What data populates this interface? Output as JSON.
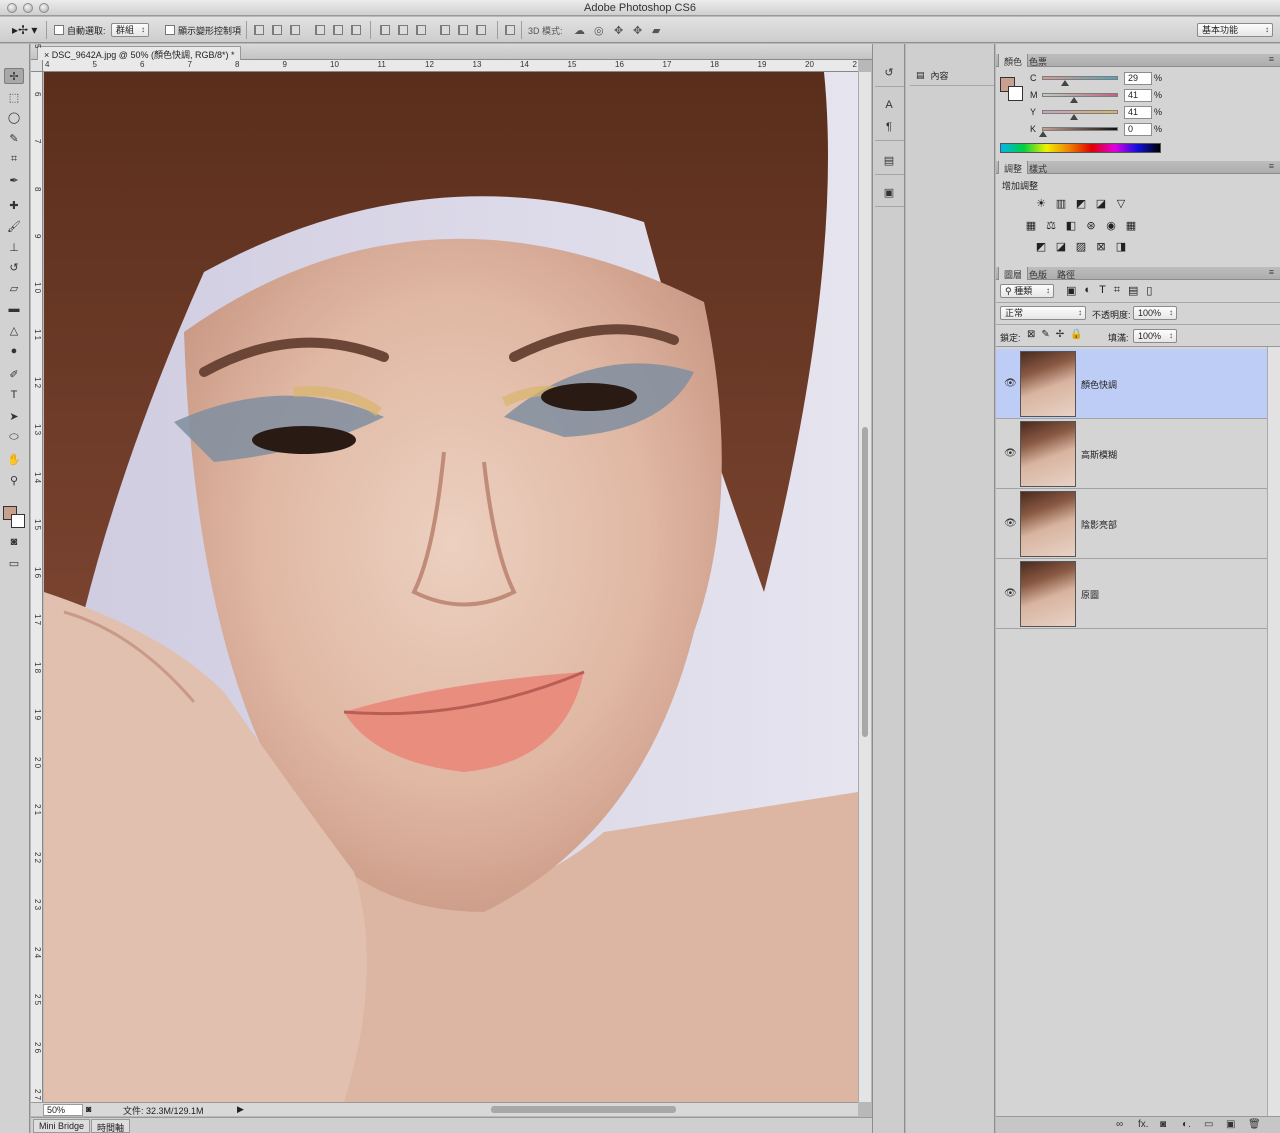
{
  "window": {
    "title": "Adobe Photoshop CS6"
  },
  "options_bar": {
    "auto_select_label": "自動選取:",
    "auto_select_target": "群組",
    "show_transform_label": "顯示變形控制項",
    "mode_3d_label": "3D 模式:",
    "workspace": "基本功能"
  },
  "document": {
    "tab_title": "DSC_9642A.jpg @ 50% (顏色快調, RGB/8*) *",
    "ruler_h": [
      "4",
      "5",
      "6",
      "7",
      "8",
      "9",
      "10",
      "11",
      "12",
      "13",
      "14",
      "15",
      "16",
      "17",
      "18",
      "19",
      "20",
      "2"
    ],
    "ruler_v": [
      "5",
      "6",
      "7",
      "8",
      "9",
      "1 0",
      "1 1",
      "1 2",
      "1 3",
      "1 4",
      "1 5",
      "1 6",
      "1 7",
      "1 8",
      "1 9",
      "2 0",
      "2 1",
      "2 2",
      "2 3",
      "2 4",
      "2 5",
      "2 6",
      "2 7"
    ],
    "zoom": "50%",
    "doc_info": "文件: 32.3M/129.1M"
  },
  "bottom_tabs": [
    "Mini Bridge",
    "時間軸"
  ],
  "properties": {
    "label": "內容"
  },
  "color_panel": {
    "tabs": [
      "顏色",
      "色票"
    ],
    "foreground": "#c9a090",
    "channels": [
      {
        "label": "C",
        "value": "29",
        "pos": 0.29
      },
      {
        "label": "M",
        "value": "41",
        "pos": 0.41
      },
      {
        "label": "Y",
        "value": "41",
        "pos": 0.41
      },
      {
        "label": "K",
        "value": "0",
        "pos": 0.0
      }
    ],
    "percent_sign": "%"
  },
  "adjustments_panel": {
    "tabs": [
      "調整",
      "樣式"
    ],
    "title": "增加調整",
    "row1": [
      "☀",
      "▥",
      "◩",
      "◪",
      "▽"
    ],
    "row2": [
      "▦",
      "⚖",
      "◧",
      "⊛",
      "◉",
      "▦"
    ],
    "row3": [
      "◩",
      "◪",
      "▨",
      "⊠",
      "◨"
    ]
  },
  "layers_panel": {
    "tabs": [
      "圖層",
      "色版",
      "路徑"
    ],
    "filter_kind": "種類",
    "blend_mode": "正常",
    "opacity_label": "不透明度:",
    "opacity": "100%",
    "lock_label": "鎖定:",
    "fill_label": "填滿:",
    "fill": "100%",
    "layers": [
      {
        "name": "顏色快調",
        "selected": true
      },
      {
        "name": "高斯模糊",
        "selected": false
      },
      {
        "name": "陰影亮部",
        "selected": false
      },
      {
        "name": "原圖",
        "selected": false
      }
    ],
    "bottom_icons": [
      "∞",
      "fx.",
      "◙",
      "◐.",
      "▭",
      "▣",
      "🗑"
    ]
  }
}
